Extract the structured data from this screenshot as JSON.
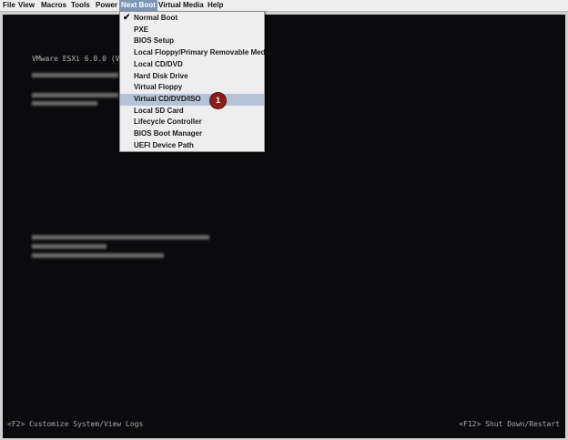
{
  "menubar": {
    "items": [
      {
        "label": "File"
      },
      {
        "label": "View"
      },
      {
        "label": "Macros"
      },
      {
        "label": "Tools"
      },
      {
        "label": "Power"
      },
      {
        "label": "Next Boot"
      },
      {
        "label": "Virtual Media"
      },
      {
        "label": "Help"
      }
    ]
  },
  "next_boot_menu": {
    "checked_item": "Normal Boot",
    "highlighted_item": "Virtual CD/DVD/ISO",
    "items": [
      {
        "label": "Normal Boot"
      },
      {
        "label": "PXE"
      },
      {
        "label": "BIOS Setup"
      },
      {
        "label": "Local Floppy/Primary Removable Media"
      },
      {
        "label": "Local CD/DVD"
      },
      {
        "label": "Hard Disk Drive"
      },
      {
        "label": "Virtual Floppy"
      },
      {
        "label": "Virtual CD/DVD/ISO"
      },
      {
        "label": "Local SD Card"
      },
      {
        "label": "Lifecycle Controller"
      },
      {
        "label": "BIOS Boot Manager"
      },
      {
        "label": "UEFI Device Path"
      }
    ]
  },
  "callout": {
    "number": "1",
    "color": "#8c1d1d"
  },
  "console": {
    "esxi_title": "VMware ESXi 6.0.0 (V",
    "footer_left": "<F2> Customize System/View Logs",
    "footer_right": "<F12> Shut Down/Restart"
  },
  "colors": {
    "menu_active": "#7d96b6",
    "menu_highlight": "#b6c3d6",
    "console_bg": "#0b0b0d"
  }
}
